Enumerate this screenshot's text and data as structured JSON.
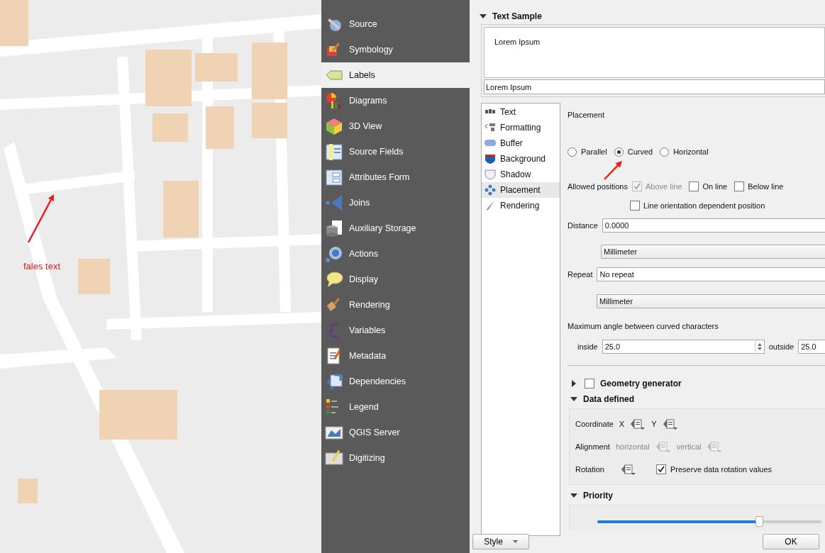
{
  "sidebar": {
    "items": [
      {
        "label": "Source",
        "selected": false
      },
      {
        "label": "Symbology",
        "selected": false
      },
      {
        "label": "Labels",
        "selected": true
      },
      {
        "label": "Diagrams",
        "selected": false
      },
      {
        "label": "3D View",
        "selected": false
      },
      {
        "label": "Source Fields",
        "selected": false
      },
      {
        "label": "Attributes Form",
        "selected": false
      },
      {
        "label": "Joins",
        "selected": false
      },
      {
        "label": "Auxiliary Storage",
        "selected": false
      },
      {
        "label": "Actions",
        "selected": false
      },
      {
        "label": "Display",
        "selected": false
      },
      {
        "label": "Rendering",
        "selected": false
      },
      {
        "label": "Variables",
        "selected": false
      },
      {
        "label": "Metadata",
        "selected": false
      },
      {
        "label": "Dependencies",
        "selected": false
      },
      {
        "label": "Legend",
        "selected": false
      },
      {
        "label": "QGIS Server",
        "selected": false
      },
      {
        "label": "Digitizing",
        "selected": false
      }
    ]
  },
  "text_sample": {
    "title": "Text Sample",
    "expanded": true,
    "preview": "Lorem Ipsum",
    "input": "Lorem Ipsum"
  },
  "tabs": [
    {
      "label": "Text",
      "selected": false
    },
    {
      "label": "Formatting",
      "selected": false
    },
    {
      "label": "Buffer",
      "selected": false
    },
    {
      "label": "Background",
      "selected": false
    },
    {
      "label": "Shadow",
      "selected": false
    },
    {
      "label": "Placement",
      "selected": true
    },
    {
      "label": "Rendering",
      "selected": false
    }
  ],
  "placement": {
    "title": "Placement",
    "modes": [
      {
        "label": "Parallel",
        "selected": false
      },
      {
        "label": "Curved",
        "selected": true
      },
      {
        "label": "Horizontal",
        "selected": false
      }
    ],
    "allowed_positions": {
      "label": "Allowed positions",
      "options": [
        {
          "label": "Above line",
          "checked": true,
          "disabled": true
        },
        {
          "label": "On line",
          "checked": false,
          "disabled": false
        },
        {
          "label": "Below line",
          "checked": false,
          "disabled": false
        }
      ]
    },
    "line_orientation": {
      "label": "Line orientation dependent position",
      "checked": false
    },
    "distance": {
      "label": "Distance",
      "value": "0.0000",
      "unit": "Millimeter"
    },
    "repeat": {
      "label": "Repeat",
      "value": "No repeat",
      "unit": "Millimeter"
    },
    "max_angle": {
      "label": "Maximum angle between curved characters",
      "inside_label": "inside",
      "inside": "25.0",
      "outside_label": "outside",
      "outside": "25.0"
    }
  },
  "geometry_generator": {
    "title": "Geometry generator",
    "expanded": false,
    "checked": false
  },
  "data_defined": {
    "title": "Data defined",
    "expanded": true,
    "coordinate": {
      "label": "Coordinate",
      "x": "X",
      "y": "Y"
    },
    "alignment": {
      "label": "Alignment",
      "horizontal": "horizontal",
      "vertical": "vertical",
      "disabled": true
    },
    "rotation": {
      "label": "Rotation",
      "preserve": {
        "label": "Preserve data rotation values",
        "checked": true
      }
    }
  },
  "priority": {
    "title": "Priority",
    "expanded": true,
    "level": 0.72
  },
  "footer": {
    "style": "Style",
    "ok": "OK"
  },
  "annotation": {
    "text": "fales text"
  }
}
